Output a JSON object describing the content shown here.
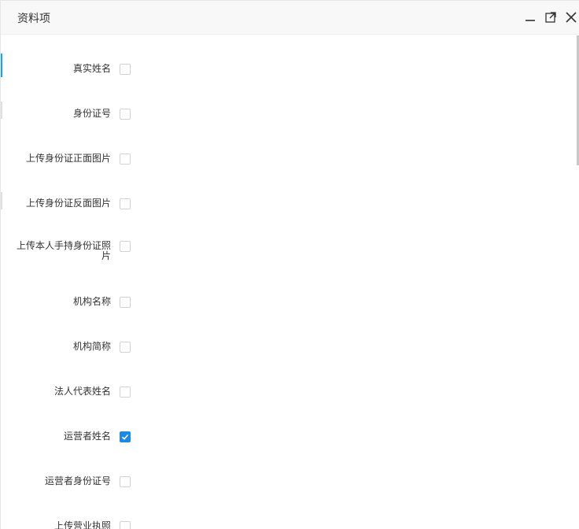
{
  "dialog": {
    "title": "资料项",
    "controls": [
      "minimize-icon",
      "maximize-icon",
      "close-icon"
    ]
  },
  "fields": [
    {
      "label": "真实姓名",
      "checked": false
    },
    {
      "label": "身份证号",
      "checked": false
    },
    {
      "label": "上传身份证正面图片",
      "checked": false
    },
    {
      "label": "上传身份证反面图片",
      "checked": false
    },
    {
      "label": "上传本人手持身份证照片",
      "checked": false
    },
    {
      "label": "机构名称",
      "checked": false
    },
    {
      "label": "机构简称",
      "checked": false
    },
    {
      "label": "法人代表姓名",
      "checked": false
    },
    {
      "label": "运营者姓名",
      "checked": true
    },
    {
      "label": "运营者身份证号",
      "checked": false
    },
    {
      "label": "上传营业执照",
      "checked": false
    }
  ],
  "colors": {
    "accent": "#1e88e5",
    "titlebar_bg": "#f8f8f8"
  }
}
